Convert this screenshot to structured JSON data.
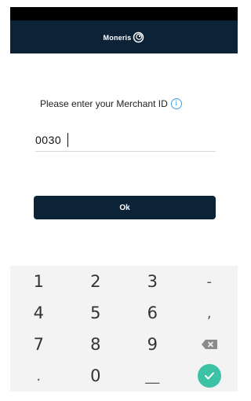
{
  "header": {
    "brand": "Moneris",
    "logo_icon": "moneris-swirl-logo-icon"
  },
  "merchant_prompt": {
    "text": "Please enter your Merchant ID",
    "info_icon": "info-icon",
    "info_glyph": "i"
  },
  "merchant_input": {
    "value": "0030"
  },
  "ok_button": {
    "label": "Ok"
  },
  "keypad": {
    "keys": [
      "1",
      "2",
      "3",
      "-",
      "4",
      "5",
      "6",
      ",",
      "7",
      "8",
      "9",
      "backspace",
      ".",
      "0",
      "_",
      "enter"
    ],
    "row1": [
      "1",
      "2",
      "3",
      "-"
    ],
    "row2": [
      "4",
      "5",
      "6",
      ","
    ],
    "row3": [
      "7",
      "8",
      "9"
    ],
    "row4": [
      ".",
      "0",
      "__"
    ],
    "backspace_icon": "backspace-icon",
    "enter_icon": "check-icon"
  },
  "colors": {
    "header_bg": "#0b2237",
    "button_bg": "#0b2237",
    "info_blue": "#3aa0e8",
    "enter_green": "#3cc2a4",
    "keypad_bg": "#f3f3f3"
  }
}
